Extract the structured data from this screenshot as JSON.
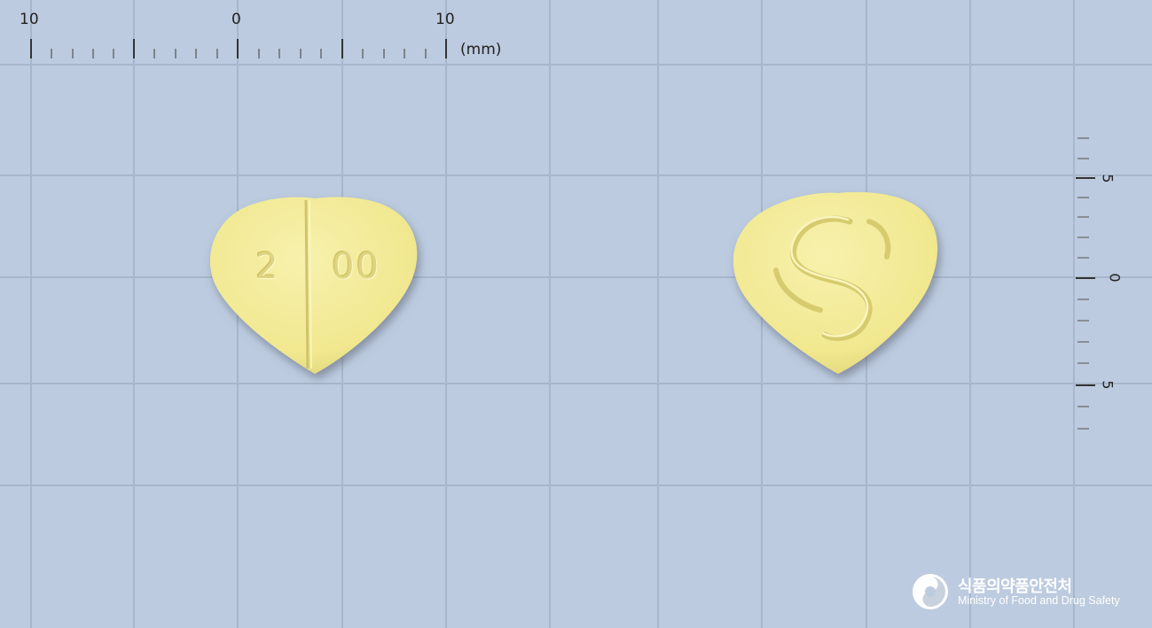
{
  "scene": {
    "subject": "two yellow heart-shaped tablets on grid background",
    "background_color": "#bccbdf",
    "grid_line_color": "#a9b8cc",
    "pill_color": "#f3ec9b",
    "pill_shade_color": "#d9cf72"
  },
  "ruler": {
    "top_labels": [
      "10",
      "0",
      "10"
    ],
    "unit": "(mm)",
    "side_labels": [
      "5",
      "0",
      "5"
    ]
  },
  "pills": [
    {
      "side": "front",
      "imprint_left": "2",
      "imprint_right": "00",
      "has_score_line": true
    },
    {
      "side": "back",
      "imprint": "S-shaped logo"
    }
  ],
  "logo": {
    "icon": "mfds-emblem-icon",
    "korean": "식품의약품안전처",
    "english": "Ministry of Food and Drug Safety"
  }
}
